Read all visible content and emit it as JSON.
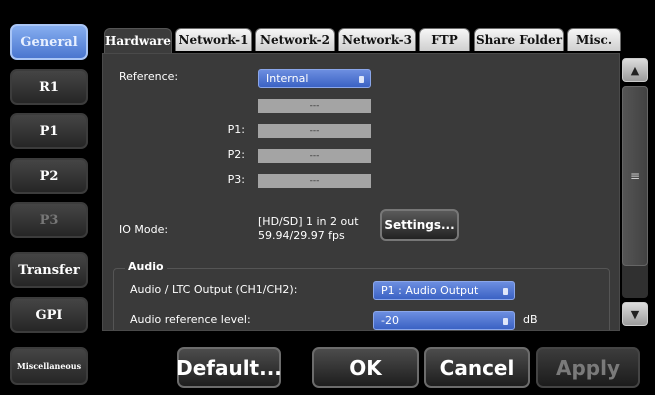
{
  "nav": {
    "items": [
      {
        "label": "General",
        "state": "active"
      },
      {
        "label": "R1",
        "state": "normal"
      },
      {
        "label": "P1",
        "state": "normal"
      },
      {
        "label": "P2",
        "state": "normal"
      },
      {
        "label": "P3",
        "state": "disabled"
      },
      {
        "label": "Transfer",
        "state": "normal"
      },
      {
        "label": "GPI",
        "state": "normal"
      },
      {
        "label": "Miscellaneous",
        "state": "normal"
      }
    ]
  },
  "tabs": [
    {
      "label": "Hardware",
      "active": true
    },
    {
      "label": "Network-1",
      "active": false
    },
    {
      "label": "Network-2",
      "active": false
    },
    {
      "label": "Network-3",
      "active": false
    },
    {
      "label": "FTP",
      "active": false
    },
    {
      "label": "Share Folder",
      "active": false
    },
    {
      "label": "Misc.",
      "active": false
    }
  ],
  "hardware": {
    "reference_label": "Reference:",
    "reference_value": "Internal",
    "ref_field_value": "---",
    "p1_label": "P1:",
    "p1_value": "---",
    "p2_label": "P2:",
    "p2_value": "---",
    "p3_label": "P3:",
    "p3_value": "---",
    "io_mode_label": "IO Mode:",
    "io_mode_line1": "[HD/SD] 1 in 2 out",
    "io_mode_line2": "59.94/29.97 fps",
    "settings_button": "Settings...",
    "audio_group_title": "Audio",
    "audio_ltc_label": "Audio / LTC Output (CH1/CH2):",
    "audio_ltc_value": "P1 : Audio Output",
    "audio_ref_label": "Audio reference level:",
    "audio_ref_value": "-20",
    "audio_ref_unit": "dB"
  },
  "scrollbar": {
    "up_icon": "▲",
    "down_icon": "▼",
    "thumb_icon": "≡"
  },
  "actions": {
    "default": "Default...",
    "ok": "OK",
    "cancel": "Cancel",
    "apply": "Apply"
  },
  "colors": {
    "accent": "#4a76cf",
    "dropdown": "#3b62c4",
    "background": "#000000",
    "panel": "#3a3a3a"
  }
}
